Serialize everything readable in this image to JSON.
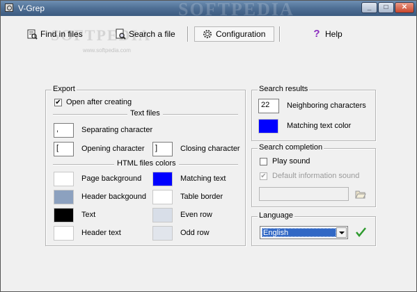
{
  "window": {
    "title": "V-Grep",
    "watermark": "SOFTPEDIA"
  },
  "toolbar": {
    "find_in_files": "Find in files",
    "search_a_file": "Search a file",
    "configuration": "Configuration",
    "help": "Help",
    "watermark": "SOFTPEDIA",
    "watermark_url": "www.softpedia.com"
  },
  "export": {
    "legend": "Export",
    "open_after_creating": "Open after creating",
    "open_after_creating_checked": true,
    "text_files": "Text files",
    "separating_character_label": "Separating character",
    "separating_character_value": ",",
    "opening_character_label": "Opening character",
    "opening_character_value": "[",
    "closing_character_label": "Closing character",
    "closing_character_value": "]",
    "html_files_colors": "HTML files colors",
    "colors": {
      "page_background": {
        "label": "Page background",
        "color": "#FFFFFF"
      },
      "matching_text": {
        "label": "Matching text",
        "color": "#0000FF"
      },
      "header_background": {
        "label": "Header backgound",
        "color": "#8CA1BF"
      },
      "table_border": {
        "label": "Table border",
        "color": "#FFFFFF"
      },
      "text": {
        "label": "Text",
        "color": "#000000"
      },
      "even_row": {
        "label": "Even row",
        "color": "#D8DEE8"
      },
      "header_text": {
        "label": "Header text",
        "color": "#FFFFFF"
      },
      "odd_row": {
        "label": "Odd row",
        "color": "#E1E5EC"
      }
    }
  },
  "search_results": {
    "legend": "Search results",
    "neighboring_value": "22",
    "neighboring_label": "Neighboring characters",
    "matching_text_color_label": "Matching text color",
    "matching_text_color": "#0000FF"
  },
  "search_completion": {
    "legend": "Search completion",
    "play_sound": "Play sound",
    "play_sound_checked": false,
    "default_information_sound": "Default information sound",
    "default_information_sound_checked": true,
    "sound_path_value": ""
  },
  "language": {
    "legend": "Language",
    "selected": "English"
  }
}
